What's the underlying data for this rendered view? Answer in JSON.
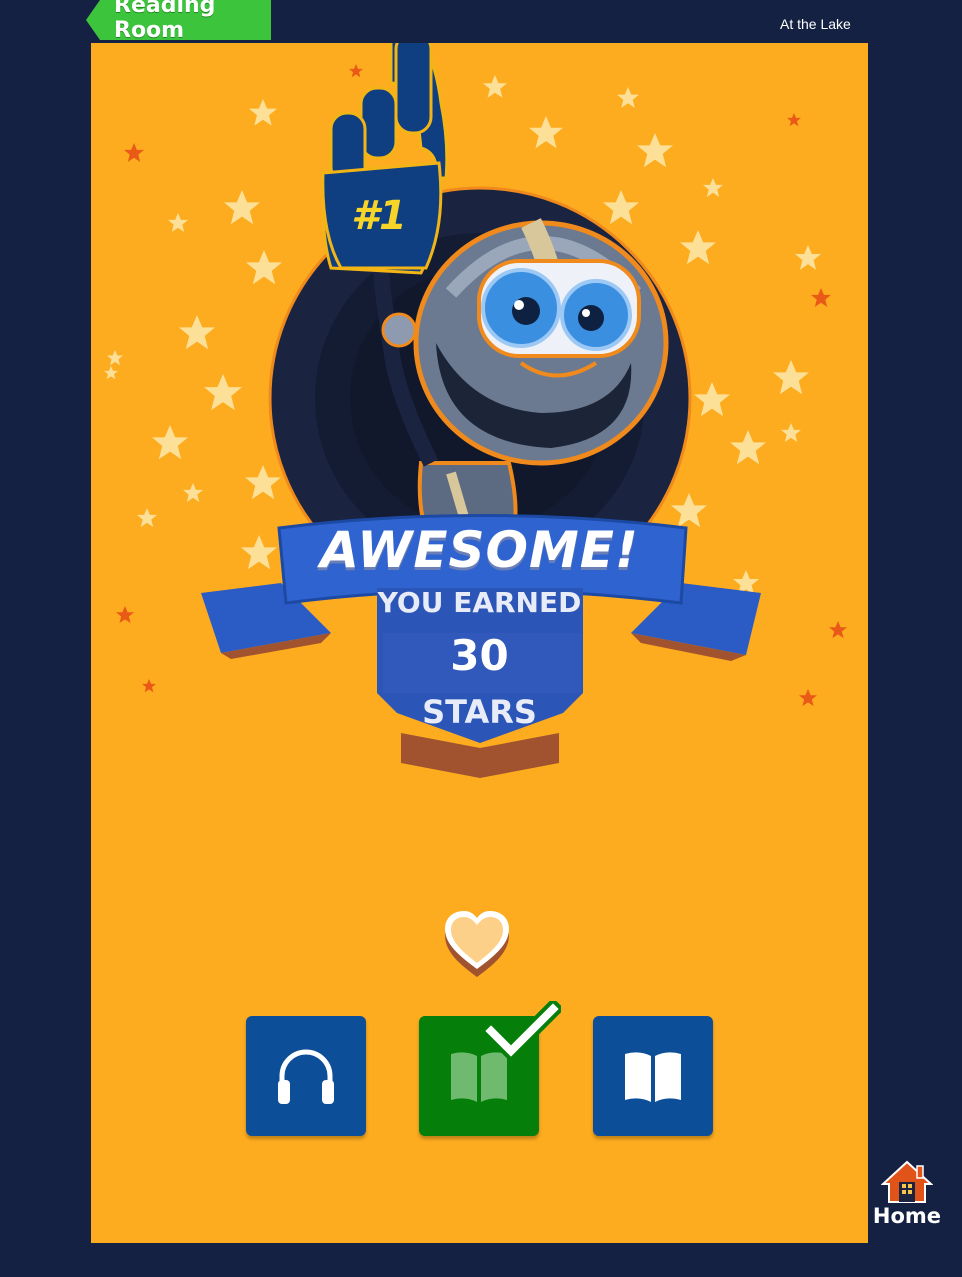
{
  "header": {
    "section_label": "Reading Room",
    "book_title": "At the Lake"
  },
  "reward": {
    "foam_finger_text": "#1",
    "headline": "AWESOME!",
    "earned_label": "YOU EARNED",
    "star_count": "30",
    "stars_label": "STARS"
  },
  "actions": {
    "listen_icon": "headphones-icon",
    "read_icon": "open-book-icon",
    "read_completed": true,
    "read_self_icon": "open-book-icon"
  },
  "nav": {
    "home_label": "Home",
    "home_icon": "house-icon"
  },
  "colors": {
    "background": "#142143",
    "panel": "#fdac1f",
    "tag_green": "#3cc43c",
    "button_blue": "#0c4e98",
    "button_green": "#057e0a",
    "banner_blue": "#2b5bc4"
  }
}
